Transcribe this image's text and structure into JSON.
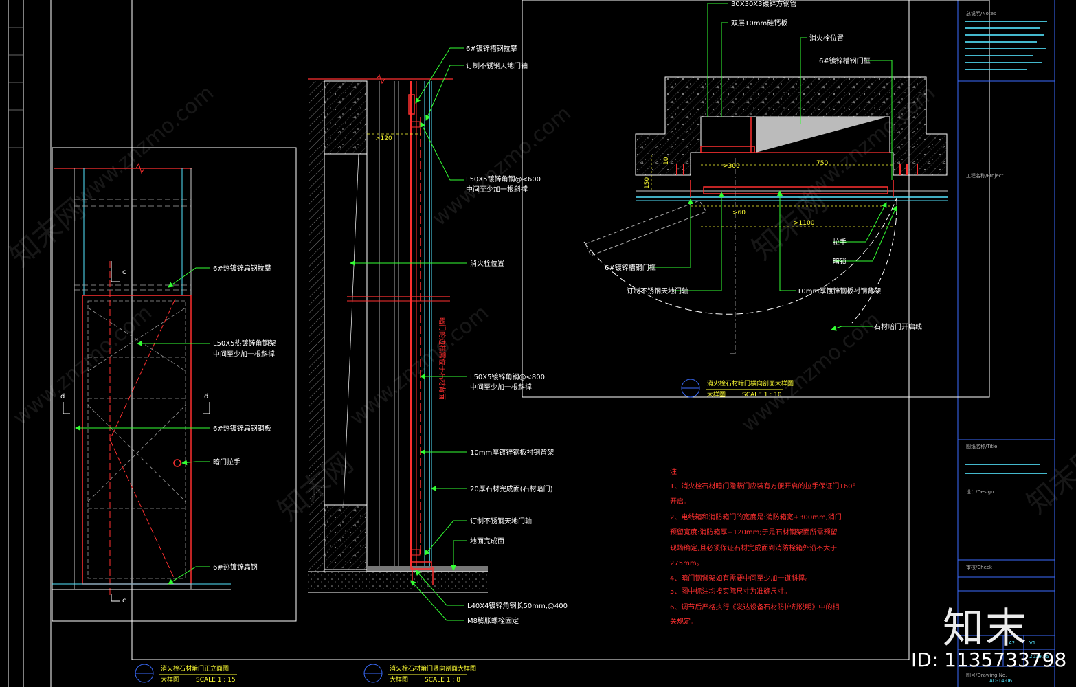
{
  "watermark": {
    "site": "www.znzmo.com",
    "brand_cn": "知末网"
  },
  "elevation_view": {
    "section_marks": [
      "c",
      "c",
      "d",
      "d"
    ],
    "callouts": [
      "6#热镀锌扁钢拉攀",
      "L50X5热镀锌角钢架",
      "中间至少加一根斜撑",
      "6#热镀锌扁钢钢板",
      "暗门拉手",
      "6#热镀锌扁钢"
    ],
    "title": "消火栓石材暗门正立面图",
    "subtitle": "大样图",
    "scale": "SCALE 1 : 15"
  },
  "vertical_section": {
    "dim": ">120",
    "vertical_text": "暗门的边框需位于石材背面",
    "callouts": [
      "6#镀锌槽钢拉攀",
      "订制不锈钢天地门轴",
      "L50X5镀锌角钢@<600",
      "中间至少加一根斜撑",
      "消火栓位置",
      "L50X5镀锌角钢@<800",
      "中间至少加一根斜撑",
      "10mm厚镀锌钢板衬钢背架",
      "20厚石材完成面(石材暗门)",
      "订制不锈钢天地门轴",
      "地面完成面",
      "L40X4镀锌角钢长50mm,@400",
      "M8膨胀螺栓固定"
    ],
    "title": "消火栓石材暗门竖向剖面大样图",
    "subtitle": "大样图",
    "scale": "SCALE 1 : 8"
  },
  "plan_section": {
    "dims": [
      ">300",
      "750",
      ">60",
      ">1100",
      "150",
      "10"
    ],
    "callouts": [
      "30X30X3镀锌方钢管",
      "双层10mm硅钙板",
      "消火栓位置",
      "6#镀锌槽钢门框",
      "拉手",
      "暗锁",
      "6#镀锌槽钢门框",
      "订制不锈钢天地门轴",
      "10mm厚镀锌钢板衬钢背架",
      "石材暗门开启线"
    ],
    "title": "消火栓石材暗门横向剖面大样图",
    "subtitle": "大样图",
    "scale": "SCALE 1 : 10"
  },
  "notes": {
    "heading": "注",
    "lines": [
      "1、消火栓石材暗门隐蔽门应装有方便开启的拉手保证门160°",
      "开启。",
      "2、电线箱和消防箱门的宽度是:消防箱宽+300mm,消门",
      "预留宽度:消防箱厚+120mm;于是石材钢架面所需预留",
      "现场确定,且必须保证石材完成面到消防栓箱外沿不大于",
      "275mm。",
      "4、暗门钢背架如有需要中间至少加一道斜撑。",
      "5、图中标注均按实际尺寸为准确尺寸。",
      "6、调节后严格执行《发达设备石材防护剂说明》中的相",
      "关规定。"
    ]
  },
  "title_block": {
    "fields": [
      "总说明/Notes",
      "工程名称/Project",
      "图纸名称/Title",
      "设计/Design",
      "审核/Check",
      "图号/Drawing No."
    ],
    "scale_value": "A2",
    "version": "V1",
    "date": "2019.05",
    "drawing_no": "AD-14-06"
  },
  "brand_logo": "知末",
  "id_tag": "ID: 1135733798"
}
